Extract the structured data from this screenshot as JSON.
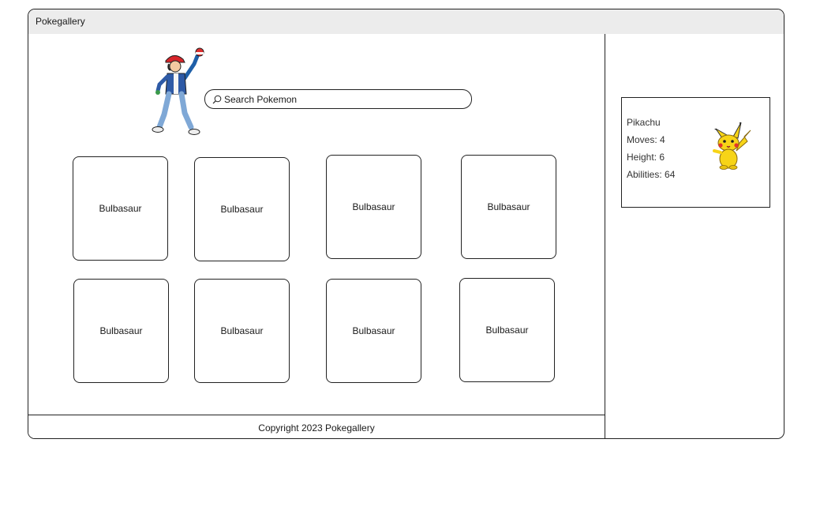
{
  "app": {
    "title": "Pokegallery"
  },
  "search": {
    "placeholder": "Search Pokemon"
  },
  "gallery": {
    "cards": [
      {
        "name": "Bulbasaur"
      },
      {
        "name": "Bulbasaur"
      },
      {
        "name": "Bulbasaur"
      },
      {
        "name": "Bulbasaur"
      },
      {
        "name": "Bulbasaur"
      },
      {
        "name": "Bulbasaur"
      },
      {
        "name": "Bulbasaur"
      },
      {
        "name": "Bulbasaur"
      }
    ]
  },
  "detail": {
    "name": "Pikachu",
    "moves": "Moves: 4",
    "height": "Height: 6",
    "abilities": "Abilities: 64"
  },
  "footer": {
    "text": "Copyright 2023 Pokegallery"
  },
  "icons": {
    "search": "search-icon",
    "hero": "trainer-illustration",
    "detail": "pikachu-illustration"
  },
  "colors": {
    "titlebar": "#ececec",
    "border": "#222222",
    "pikachu": "#f7d417"
  }
}
